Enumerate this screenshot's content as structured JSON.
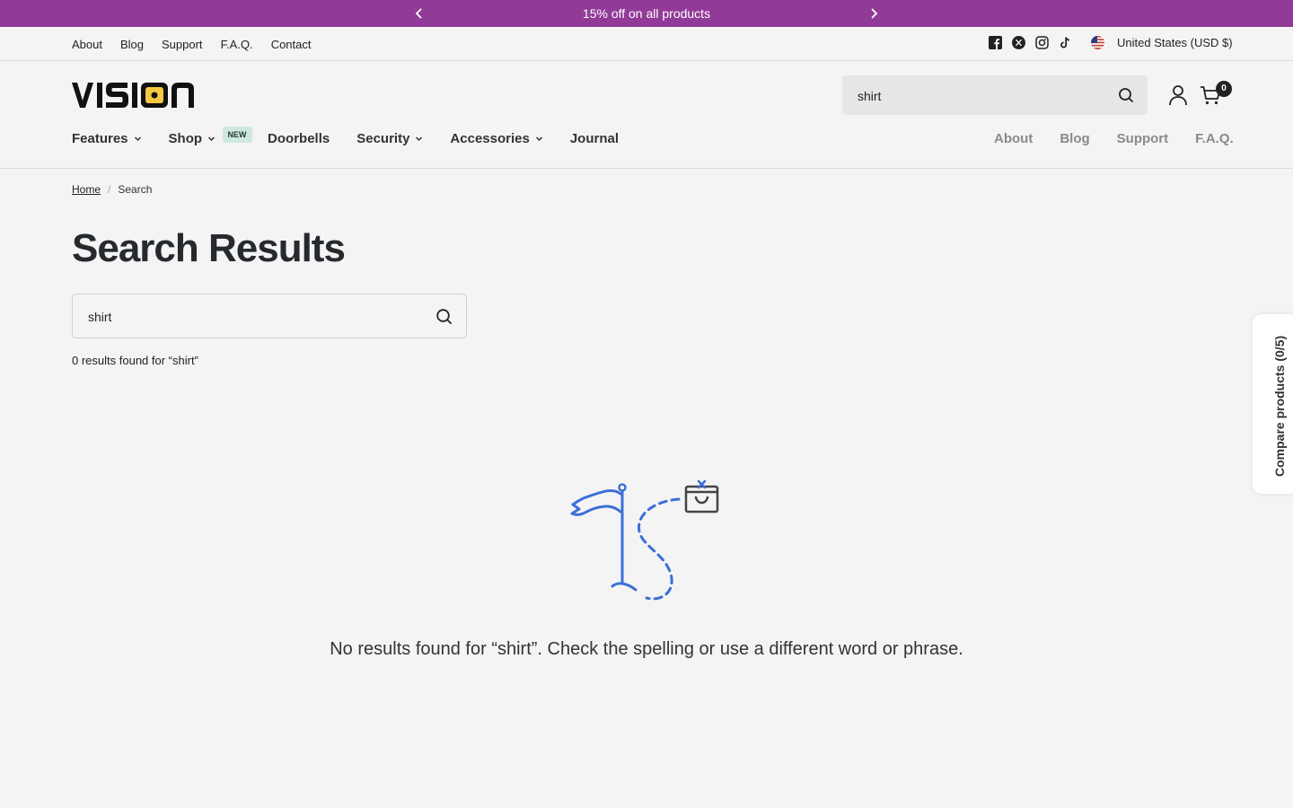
{
  "announcement": {
    "text": "15% off on all products"
  },
  "utility": {
    "links": [
      "About",
      "Blog",
      "Support",
      "F.A.Q.",
      "Contact"
    ],
    "social_icons": [
      "facebook-icon",
      "x-twitter-icon",
      "instagram-icon",
      "tiktok-icon"
    ],
    "country": "United States (USD $)"
  },
  "header": {
    "logo": "VISION",
    "search_value": "shirt",
    "cart_count": "0"
  },
  "nav": {
    "features": "Features",
    "shop": "Shop",
    "shop_badge": "NEW",
    "doorbells": "Doorbells",
    "security": "Security",
    "accessories": "Accessories",
    "journal": "Journal",
    "secondary": [
      "About",
      "Blog",
      "Support",
      "F.A.Q."
    ]
  },
  "breadcrumb": {
    "home": "Home",
    "sep": "/",
    "current": "Search"
  },
  "main": {
    "title": "Search Results",
    "search_value": "shirt",
    "results_count": "0 results found for “shirt”",
    "empty_message": "No results found for “shirt”. Check the spelling or use a different word or phrase."
  },
  "compare": {
    "label": "Compare products (0/5)"
  },
  "colors": {
    "announce_bg": "#923a97",
    "accent_blue": "#3b6fd8",
    "logo_yellow": "#f6c944"
  }
}
